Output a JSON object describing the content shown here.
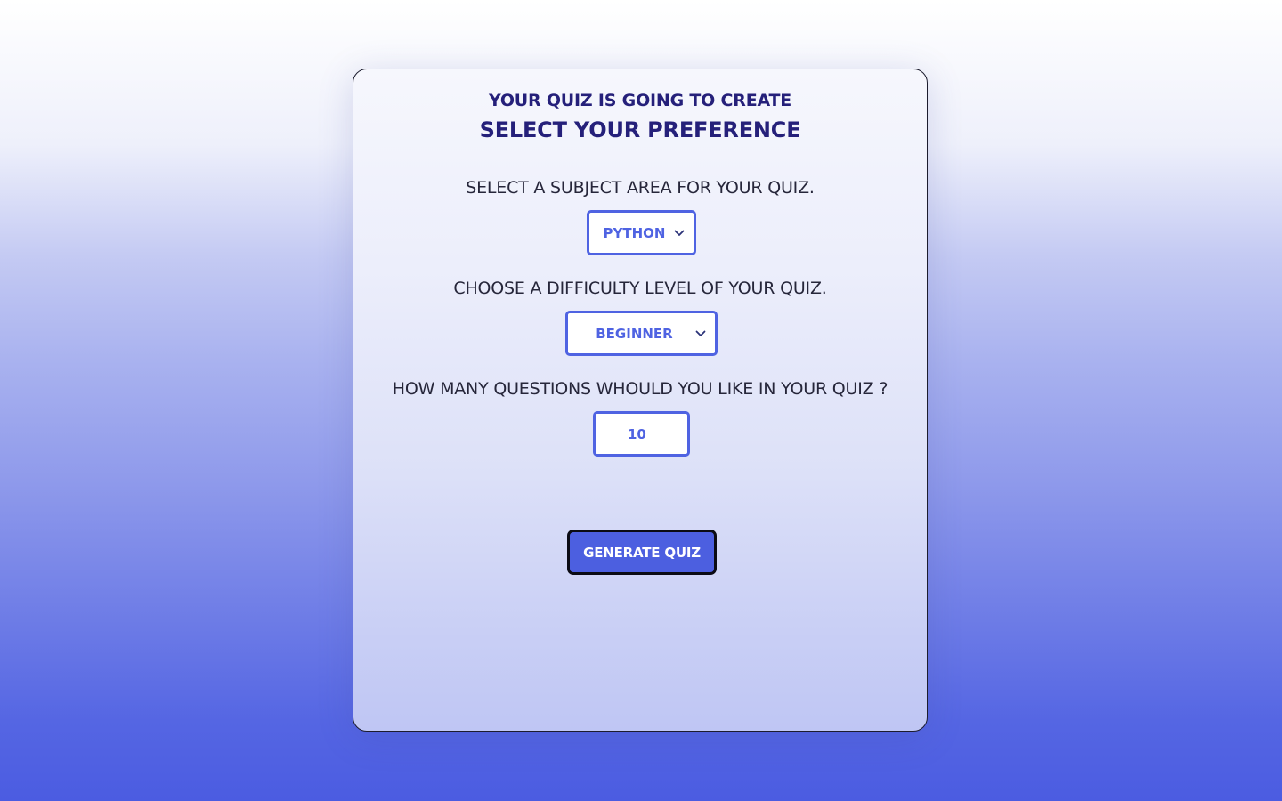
{
  "header": {
    "subtitle": "YOUR QUIZ IS GOING TO CREATE",
    "title": "SELECT YOUR PREFERENCE"
  },
  "form": {
    "subject": {
      "label": "SELECT A SUBJECT AREA FOR YOUR QUIZ.",
      "selected": "PYTHON"
    },
    "difficulty": {
      "label": "CHOOSE A DIFFICULTY LEVEL OF YOUR QUIZ.",
      "selected": "BEGINNER"
    },
    "questions": {
      "label": "HOW MANY QUESTIONS WHOULD YOU LIKE IN YOUR QUIZ ?",
      "value": "10"
    },
    "submit_label": "GENERATE QUIZ"
  },
  "colors": {
    "accent": "#4f63e2",
    "heading": "#25207a",
    "button_bg": "#4c5fe0"
  },
  "icons": {
    "select_chevron": "chevron-down-icon"
  }
}
